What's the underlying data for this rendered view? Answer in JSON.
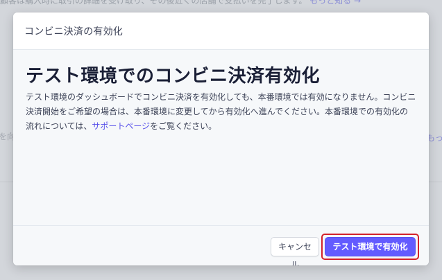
{
  "background": {
    "top_text": "顧客は購入時に取引の詳細を受け取り、その後近くの店舗で支払いを完了します。",
    "top_link": "もっと知る →",
    "left_fragment": "を向",
    "right_fragment": "もっ"
  },
  "modal": {
    "title": "コンビニ決済の有効化",
    "heading": "テスト環境でのコンビニ決済有効化",
    "body_text_1": "テスト環境のダッシュボードでコンビニ決済を有効化しても、本番環境では有効になりません。コンビニ決済開始をご希望の場合は、本番環境に変更してから有効化へ進んでください。本番環境での有効化の流れについては、",
    "support_link": "サポートページ",
    "body_text_2": "をご覧ください。",
    "cancel_label": "キャンセル",
    "primary_label": "テスト環境で有効化"
  },
  "colors": {
    "accent": "#635bff",
    "highlight_border": "#d3212b"
  }
}
